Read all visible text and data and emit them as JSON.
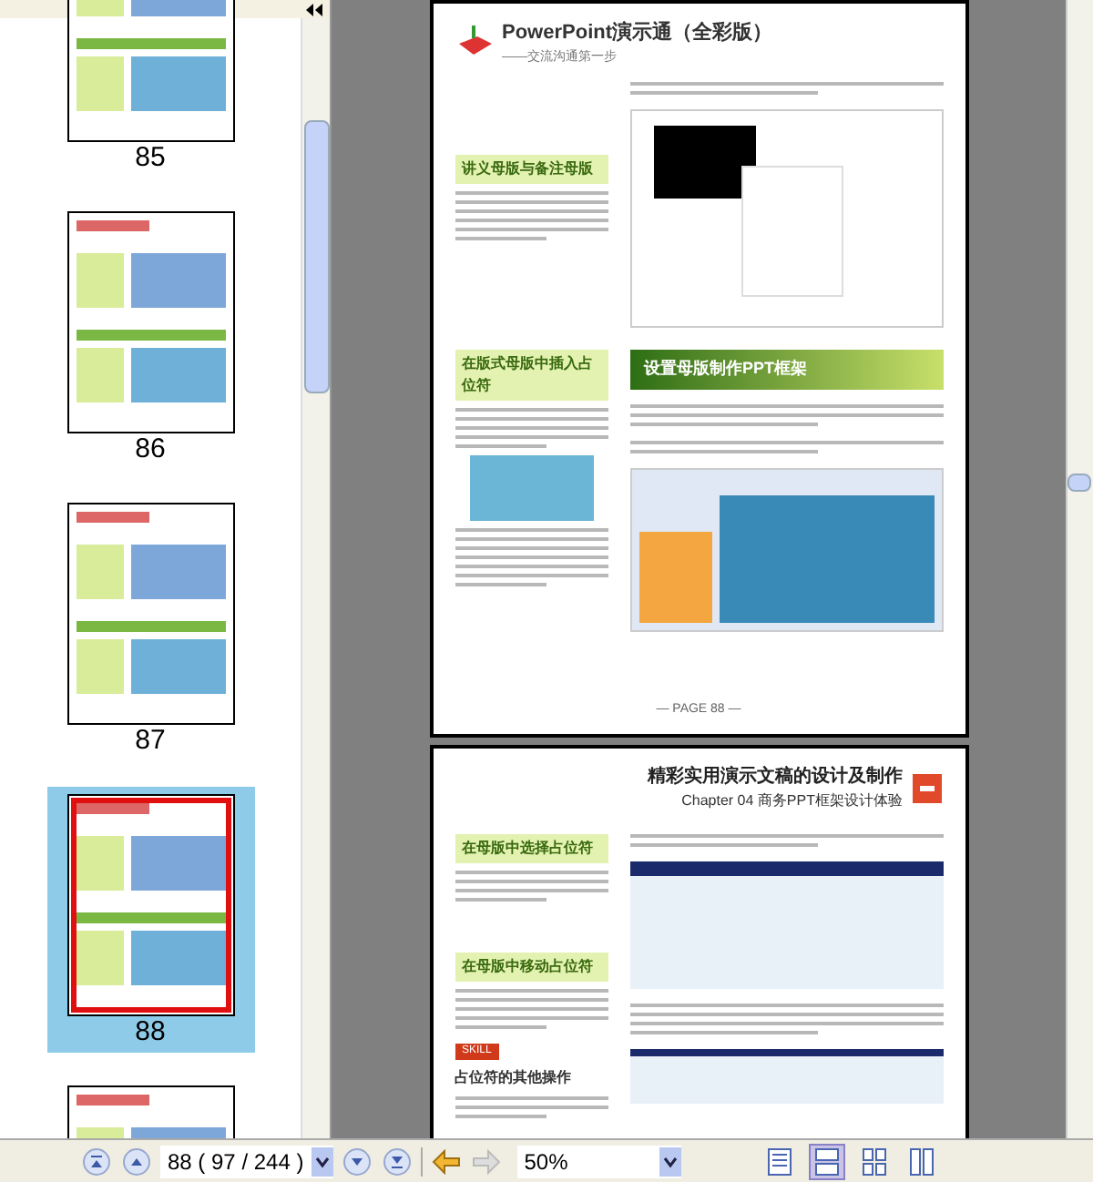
{
  "thumbnails": [
    {
      "label": "85",
      "selected": false
    },
    {
      "label": "86",
      "selected": false
    },
    {
      "label": "87",
      "selected": false
    },
    {
      "label": "88",
      "selected": true
    },
    {
      "selected": false
    }
  ],
  "page_top": {
    "book_title": "PowerPoint演示通（全彩版）",
    "book_subtitle": "——交流沟通第一步",
    "side_heading_1": "讲义母版与备注母版",
    "side_heading_2": "在版式母版中插入占位符",
    "section_banner": "设置母版制作PPT框架",
    "footer": "— PAGE 88 —"
  },
  "page_bottom": {
    "book_title": "精彩实用演示文稿的设计及制作",
    "chapter": "Chapter 04  商务PPT框架设计体验",
    "side_heading_1": "在母版中选择占位符",
    "side_heading_2": "在母版中移动占位符",
    "skill_tag": "SKILL",
    "skill_title": "占位符的其他操作"
  },
  "toolbar": {
    "page_field": "88 ( 97 / 244 )",
    "zoom_field": "50%",
    "view_modes": [
      {
        "selected": false
      },
      {
        "selected": true
      },
      {
        "selected": false
      },
      {
        "selected": false
      }
    ]
  }
}
